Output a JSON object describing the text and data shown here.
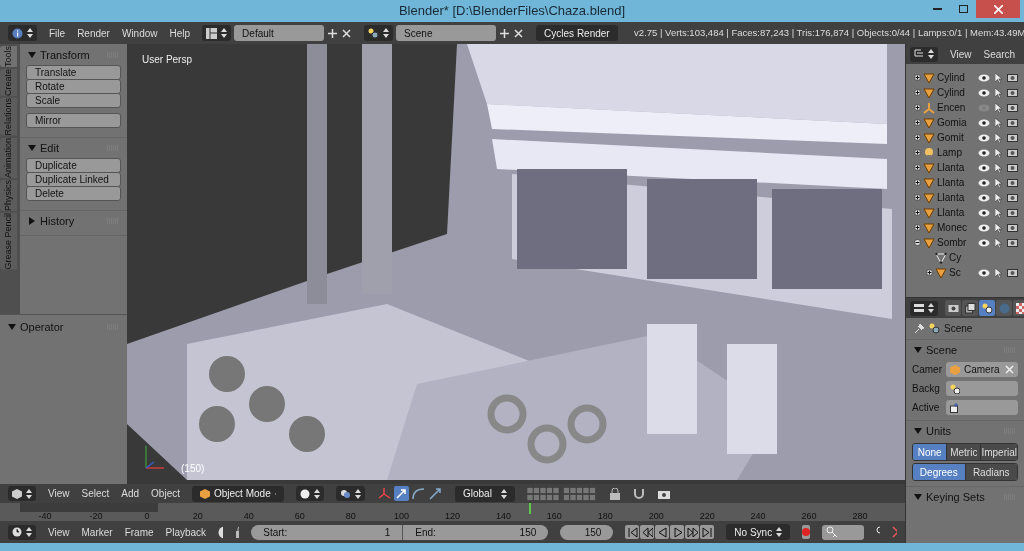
{
  "window": {
    "title": "Blender* [D:\\BlenderFiles\\Chaza.blend]"
  },
  "info_header": {
    "menus": [
      "File",
      "Render",
      "Window",
      "Help"
    ],
    "layout": "Default",
    "scene": "Scene",
    "engine": "Cycles Render",
    "stats": "v2.75 | Verts:103,484 | Faces:87,243 | Tris:176,874 | Objects:0/44 | Lamps:0/1 | Mem:43.49M"
  },
  "tool_shelf": {
    "tabs": [
      {
        "label": "Tools",
        "selected": true
      },
      {
        "label": "Create",
        "selected": false
      },
      {
        "label": "Relations",
        "selected": false
      },
      {
        "label": "Animation",
        "selected": false
      },
      {
        "label": "Physics",
        "selected": false
      },
      {
        "label": "Grease Pencil",
        "selected": false
      }
    ],
    "panels": [
      {
        "title": "Transform",
        "expanded": true,
        "groups": [
          [
            "Translate",
            "Rotate",
            "Scale"
          ],
          [
            "Mirror"
          ]
        ]
      },
      {
        "title": "Edit",
        "expanded": true,
        "groups": [
          [
            "Duplicate",
            "Duplicate Linked",
            "Delete"
          ]
        ]
      },
      {
        "title": "History",
        "expanded": false
      }
    ],
    "operator": {
      "title": "Operator",
      "expanded": true
    }
  },
  "viewport": {
    "view_label": "User Persp",
    "frame": "(150)"
  },
  "view3d_header": {
    "menus": [
      "View",
      "Select",
      "Add",
      "Object"
    ],
    "mode": "Object Mode",
    "orientation": "Global"
  },
  "timeline": {
    "ticks": [
      "-40",
      "-20",
      "0",
      "20",
      "40",
      "60",
      "80",
      "100",
      "120",
      "140",
      "160",
      "180",
      "200",
      "220",
      "240",
      "260",
      "280"
    ],
    "playhead": {
      "level": 0.594
    }
  },
  "timeline_header": {
    "menus": [
      "View",
      "Marker",
      "Frame",
      "Playback"
    ],
    "start_label": "Start:",
    "start": "1",
    "end_label": "End:",
    "end": "150",
    "current": "150",
    "sync": "No Sync"
  },
  "outliner": {
    "menus": [
      "View",
      "Search"
    ],
    "items": [
      {
        "name": "Cylind",
        "kind": "mesh",
        "visible": true,
        "expanded": false
      },
      {
        "name": "Cylind",
        "kind": "mesh",
        "visible": true,
        "expanded": false
      },
      {
        "name": "Encen",
        "kind": "empty",
        "visible": false,
        "expanded": false
      },
      {
        "name": "Gomia",
        "kind": "mesh",
        "visible": true,
        "expanded": false
      },
      {
        "name": "Gomit",
        "kind": "mesh",
        "visible": true,
        "expanded": false
      },
      {
        "name": "Lamp",
        "kind": "lamp",
        "visible": true,
        "expanded": false
      },
      {
        "name": "Llanta",
        "kind": "mesh",
        "visible": true,
        "expanded": false
      },
      {
        "name": "Llanta",
        "kind": "mesh",
        "visible": true,
        "expanded": false
      },
      {
        "name": "Llanta",
        "kind": "mesh",
        "visible": true,
        "expanded": false
      },
      {
        "name": "Llanta",
        "kind": "mesh",
        "visible": true,
        "expanded": false
      },
      {
        "name": "Monec",
        "kind": "mesh",
        "visible": true,
        "expanded": false
      },
      {
        "name": "Sombr",
        "kind": "mesh",
        "visible": true,
        "expanded": true,
        "children": [
          {
            "name": "Cy",
            "kind": "mesh_data"
          },
          {
            "name": "Sc",
            "kind": "mesh",
            "visible": true,
            "expanded": false
          }
        ]
      }
    ]
  },
  "properties": {
    "tabs": [
      {
        "kind": "render",
        "selected": false
      },
      {
        "kind": "layers",
        "selected": false
      },
      {
        "kind": "scene",
        "selected": true
      },
      {
        "kind": "world",
        "selected": false
      },
      {
        "kind": "texture",
        "selected": false
      }
    ],
    "breadcrumb": "Scene",
    "scene_panel": {
      "title": "Scene",
      "expanded": true,
      "fields": [
        {
          "label": "Camer",
          "value": "Camera",
          "kind": "camera"
        },
        {
          "label": "Backg",
          "kind": "scene"
        },
        {
          "label": "Active",
          "kind": "keying"
        }
      ]
    },
    "units_panel": {
      "title": "Units",
      "expanded": true,
      "systems": [
        {
          "label": "None",
          "selected": true
        },
        {
          "label": "Metric",
          "selected": false
        },
        {
          "label": "Imperial",
          "selected": false
        }
      ],
      "rotation": [
        {
          "label": "Degrees",
          "selected": true
        },
        {
          "label": "Radians",
          "selected": false
        }
      ]
    },
    "keying_panel": {
      "title": "Keying Sets",
      "expanded": true
    }
  }
}
